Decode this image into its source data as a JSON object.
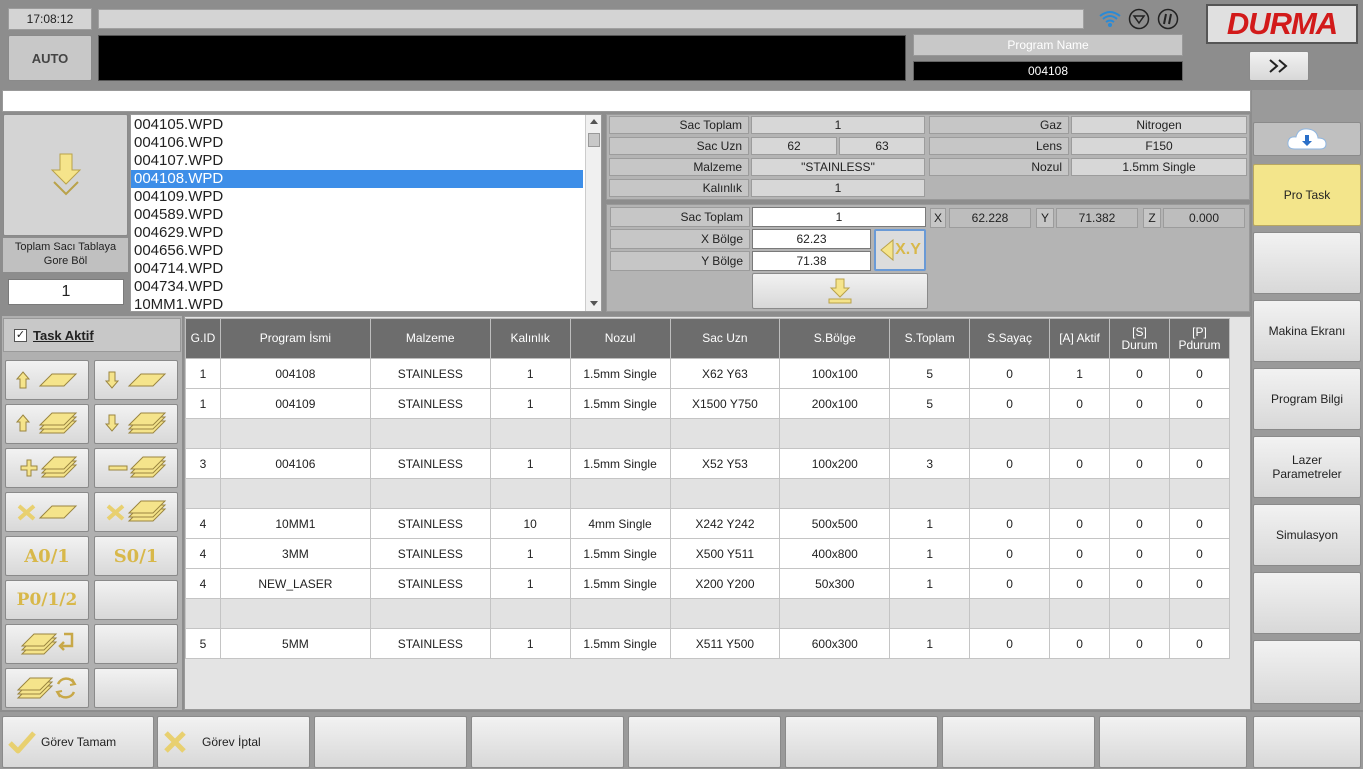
{
  "header": {
    "clock": "17:08:12",
    "mode": "AUTO",
    "program_name_label": "Program Name",
    "program_name_value": "004108",
    "brand": "DURMA"
  },
  "file_panel": {
    "split_label": "Toplam Sacı Tablaya Gore Böl",
    "split_value": "1",
    "files": [
      "004105.WPD",
      "004106.WPD",
      "004107.WPD",
      "004108.WPD",
      "004109.WPD",
      "004589.WPD",
      "004629.WPD",
      "004656.WPD",
      "004714.WPD",
      "004734.WPD",
      "10MM1.WPD"
    ],
    "selected_index": 3
  },
  "info": {
    "sac_toplam_label": "Sac Toplam",
    "sac_toplam": "1",
    "sac_uzn_label": "Sac Uzn",
    "sac_uzn_x": "62",
    "sac_uzn_y": "63",
    "malzeme_label": "Malzeme",
    "malzeme": "\"STAINLESS\"",
    "kalinlik_label": "Kalınlık",
    "kalinlik": "1",
    "gaz_label": "Gaz",
    "gaz": "Nitrogen",
    "lens_label": "Lens",
    "lens": "F150",
    "nozul_label": "Nozul",
    "nozul": "1.5mm Single"
  },
  "region": {
    "sac_toplam_label": "Sac Toplam",
    "sac_toplam": "1",
    "x_bolge_label": "X Bölge",
    "x_bolge": "62.23",
    "y_bolge_label": "Y Bölge",
    "y_bolge": "71.38",
    "x_label": "X",
    "x_pos": "62.228",
    "y_label": "Y",
    "y_pos": "71.382",
    "z_label": "Z",
    "z_pos": "0.000",
    "xy_button": "X.Y"
  },
  "task_aktif": {
    "label": "Task Aktif",
    "checked": true
  },
  "tool_buttons": {
    "a01": "A0/1",
    "s01": "S0/1",
    "p012": "P0/1/2"
  },
  "table": {
    "headers": [
      "G.ID",
      "Program İsmi",
      "Malzeme",
      "Kalınlık",
      "Nozul",
      "Sac Uzn",
      "S.Bölge",
      "S.Toplam",
      "S.Sayaç",
      "[A] Aktif",
      "[S] Durum",
      "[P] Pdurum"
    ],
    "rows": [
      [
        "1",
        "004108",
        "STAINLESS",
        "1",
        "1.5mm Single",
        "X62 Y63",
        "100x100",
        "5",
        "0",
        "1",
        "0",
        "0"
      ],
      [
        "1",
        "004109",
        "STAINLESS",
        "1",
        "1.5mm Single",
        "X1500 Y750",
        "200x100",
        "5",
        "0",
        "0",
        "0",
        "0"
      ],
      [
        "",
        "",
        "",
        "",
        "",
        "",
        "",
        "",
        "",
        "",
        "",
        ""
      ],
      [
        "3",
        "004106",
        "STAINLESS",
        "1",
        "1.5mm Single",
        "X52 Y53",
        "100x200",
        "3",
        "0",
        "0",
        "0",
        "0"
      ],
      [
        "",
        "",
        "",
        "",
        "",
        "",
        "",
        "",
        "",
        "",
        "",
        ""
      ],
      [
        "4",
        "10MM1",
        "STAINLESS",
        "10",
        "4mm Single",
        "X242 Y242",
        "500x500",
        "1",
        "0",
        "0",
        "0",
        "0"
      ],
      [
        "4",
        "3MM",
        "STAINLESS",
        "1",
        "1.5mm Single",
        "X500 Y511",
        "400x800",
        "1",
        "0",
        "0",
        "0",
        "0"
      ],
      [
        "4",
        "NEW_LASER",
        "STAINLESS",
        "1",
        "1.5mm Single",
        "X200 Y200",
        "50x300",
        "1",
        "0",
        "0",
        "0",
        "0"
      ],
      [
        "",
        "",
        "",
        "",
        "",
        "",
        "",
        "",
        "",
        "",
        "",
        ""
      ],
      [
        "5",
        "5MM",
        "STAINLESS",
        "1",
        "1.5mm Single",
        "X511 Y500",
        "600x300",
        "1",
        "0",
        "0",
        "0",
        "0"
      ]
    ]
  },
  "side_menu": {
    "pro_task": "Pro Task",
    "makina_ekrani": "Makina Ekranı",
    "program_bilgi": "Program Bilgi",
    "lazer_parametreler": "Lazer Parametreler",
    "simulasyon": "Simulasyon"
  },
  "footer": {
    "gorev_tamam": "Görev Tamam",
    "gorev_iptal": "Görev İptal"
  },
  "colors": {
    "accent_yellow": "#f3e58b",
    "selection_blue": "#3d8ee8",
    "brand_red": "#d21a1a",
    "header_gray": "#6d6d6d"
  }
}
